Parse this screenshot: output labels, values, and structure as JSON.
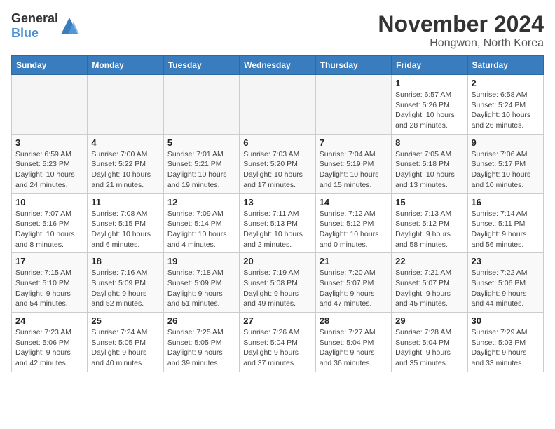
{
  "header": {
    "logo_general": "General",
    "logo_blue": "Blue",
    "month_title": "November 2024",
    "location": "Hongwon, North Korea"
  },
  "weekdays": [
    "Sunday",
    "Monday",
    "Tuesday",
    "Wednesday",
    "Thursday",
    "Friday",
    "Saturday"
  ],
  "weeks": [
    [
      {
        "day": "",
        "info": ""
      },
      {
        "day": "",
        "info": ""
      },
      {
        "day": "",
        "info": ""
      },
      {
        "day": "",
        "info": ""
      },
      {
        "day": "",
        "info": ""
      },
      {
        "day": "1",
        "info": "Sunrise: 6:57 AM\nSunset: 5:26 PM\nDaylight: 10 hours\nand 28 minutes."
      },
      {
        "day": "2",
        "info": "Sunrise: 6:58 AM\nSunset: 5:24 PM\nDaylight: 10 hours\nand 26 minutes."
      }
    ],
    [
      {
        "day": "3",
        "info": "Sunrise: 6:59 AM\nSunset: 5:23 PM\nDaylight: 10 hours\nand 24 minutes."
      },
      {
        "day": "4",
        "info": "Sunrise: 7:00 AM\nSunset: 5:22 PM\nDaylight: 10 hours\nand 21 minutes."
      },
      {
        "day": "5",
        "info": "Sunrise: 7:01 AM\nSunset: 5:21 PM\nDaylight: 10 hours\nand 19 minutes."
      },
      {
        "day": "6",
        "info": "Sunrise: 7:03 AM\nSunset: 5:20 PM\nDaylight: 10 hours\nand 17 minutes."
      },
      {
        "day": "7",
        "info": "Sunrise: 7:04 AM\nSunset: 5:19 PM\nDaylight: 10 hours\nand 15 minutes."
      },
      {
        "day": "8",
        "info": "Sunrise: 7:05 AM\nSunset: 5:18 PM\nDaylight: 10 hours\nand 13 minutes."
      },
      {
        "day": "9",
        "info": "Sunrise: 7:06 AM\nSunset: 5:17 PM\nDaylight: 10 hours\nand 10 minutes."
      }
    ],
    [
      {
        "day": "10",
        "info": "Sunrise: 7:07 AM\nSunset: 5:16 PM\nDaylight: 10 hours\nand 8 minutes."
      },
      {
        "day": "11",
        "info": "Sunrise: 7:08 AM\nSunset: 5:15 PM\nDaylight: 10 hours\nand 6 minutes."
      },
      {
        "day": "12",
        "info": "Sunrise: 7:09 AM\nSunset: 5:14 PM\nDaylight: 10 hours\nand 4 minutes."
      },
      {
        "day": "13",
        "info": "Sunrise: 7:11 AM\nSunset: 5:13 PM\nDaylight: 10 hours\nand 2 minutes."
      },
      {
        "day": "14",
        "info": "Sunrise: 7:12 AM\nSunset: 5:12 PM\nDaylight: 10 hours\nand 0 minutes."
      },
      {
        "day": "15",
        "info": "Sunrise: 7:13 AM\nSunset: 5:12 PM\nDaylight: 9 hours\nand 58 minutes."
      },
      {
        "day": "16",
        "info": "Sunrise: 7:14 AM\nSunset: 5:11 PM\nDaylight: 9 hours\nand 56 minutes."
      }
    ],
    [
      {
        "day": "17",
        "info": "Sunrise: 7:15 AM\nSunset: 5:10 PM\nDaylight: 9 hours\nand 54 minutes."
      },
      {
        "day": "18",
        "info": "Sunrise: 7:16 AM\nSunset: 5:09 PM\nDaylight: 9 hours\nand 52 minutes."
      },
      {
        "day": "19",
        "info": "Sunrise: 7:18 AM\nSunset: 5:09 PM\nDaylight: 9 hours\nand 51 minutes."
      },
      {
        "day": "20",
        "info": "Sunrise: 7:19 AM\nSunset: 5:08 PM\nDaylight: 9 hours\nand 49 minutes."
      },
      {
        "day": "21",
        "info": "Sunrise: 7:20 AM\nSunset: 5:07 PM\nDaylight: 9 hours\nand 47 minutes."
      },
      {
        "day": "22",
        "info": "Sunrise: 7:21 AM\nSunset: 5:07 PM\nDaylight: 9 hours\nand 45 minutes."
      },
      {
        "day": "23",
        "info": "Sunrise: 7:22 AM\nSunset: 5:06 PM\nDaylight: 9 hours\nand 44 minutes."
      }
    ],
    [
      {
        "day": "24",
        "info": "Sunrise: 7:23 AM\nSunset: 5:06 PM\nDaylight: 9 hours\nand 42 minutes."
      },
      {
        "day": "25",
        "info": "Sunrise: 7:24 AM\nSunset: 5:05 PM\nDaylight: 9 hours\nand 40 minutes."
      },
      {
        "day": "26",
        "info": "Sunrise: 7:25 AM\nSunset: 5:05 PM\nDaylight: 9 hours\nand 39 minutes."
      },
      {
        "day": "27",
        "info": "Sunrise: 7:26 AM\nSunset: 5:04 PM\nDaylight: 9 hours\nand 37 minutes."
      },
      {
        "day": "28",
        "info": "Sunrise: 7:27 AM\nSunset: 5:04 PM\nDaylight: 9 hours\nand 36 minutes."
      },
      {
        "day": "29",
        "info": "Sunrise: 7:28 AM\nSunset: 5:04 PM\nDaylight: 9 hours\nand 35 minutes."
      },
      {
        "day": "30",
        "info": "Sunrise: 7:29 AM\nSunset: 5:03 PM\nDaylight: 9 hours\nand 33 minutes."
      }
    ]
  ]
}
